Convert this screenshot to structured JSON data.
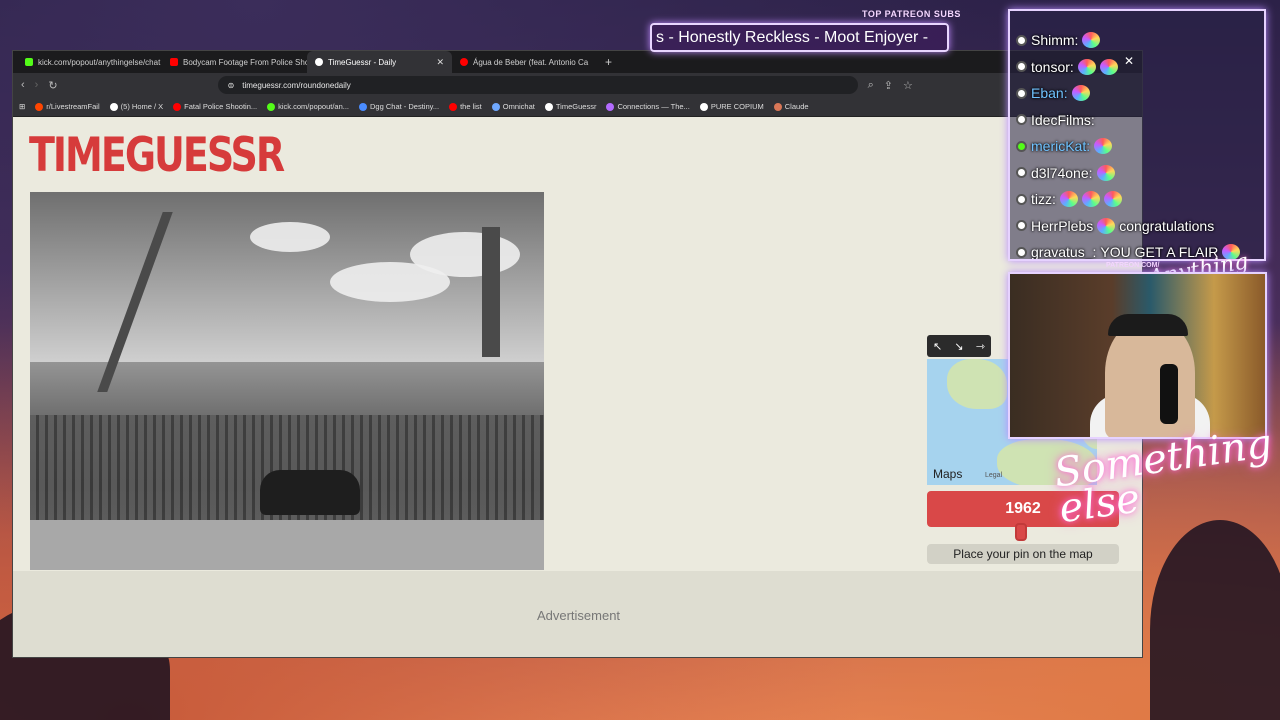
{
  "browser": {
    "tabs": [
      {
        "label": "kick.com/popout/anythingelse/chat",
        "color": "#53fc18"
      },
      {
        "label": "Bodycam Footage From Police Shoot",
        "color": "#ff0000"
      },
      {
        "label": "TimeGuessr - Daily",
        "color": "#ffffff",
        "active": true
      },
      {
        "label": "Água de Beber (feat. Antonio Ca",
        "color": "#ff0000"
      }
    ],
    "url": "timeguessr.com/roundonedaily",
    "bookmarks": [
      "r/LivestreamFail",
      "(5) Home / X",
      "Fatal Police Shootin...",
      "kick.com/popout/an...",
      "Dgg Chat - Destiny...",
      "the list",
      "Omnichat",
      "TimeGuessr",
      "Connections — The...",
      "PURE COPIUM",
      "Claude"
    ]
  },
  "game": {
    "logo": "TIMEGUESSR",
    "year": "1962",
    "place_pin_label": "Place your pin on the map",
    "map_brand": "Maps",
    "map_legal": "Legal",
    "advertisement": "Advertisement"
  },
  "overlay": {
    "patreon_title": "TOP PATREON SUBS",
    "ticker": "s - Honestly Reckless - Moot Enjoyer -",
    "patreon_url": "PATREON.COM/",
    "chat": [
      {
        "user": "Shimm:",
        "msg": ""
      },
      {
        "user": "tonsor:",
        "msg": ""
      },
      {
        "user": "Eban:",
        "msg": ""
      },
      {
        "user": "IdecFilms:",
        "msg": ""
      },
      {
        "user": "mericKat:",
        "msg": ""
      },
      {
        "user": "d3l74one:",
        "msg": ""
      },
      {
        "user": "tizz:",
        "msg": ""
      },
      {
        "user": "HerrPlebs",
        "msg": "congratulations"
      },
      {
        "user": "gravatus_:",
        "msg": "YOU GET A FLAIR"
      }
    ],
    "script_logo": "Something else",
    "script_small": "Anything else"
  }
}
